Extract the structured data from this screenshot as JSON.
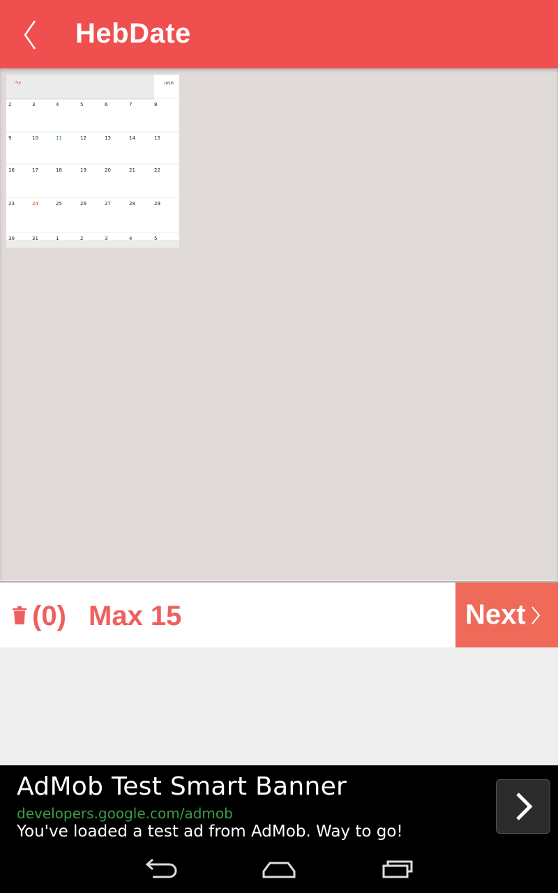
{
  "appbar": {
    "title": "HebDate"
  },
  "gallery": {
    "thumbnail": {
      "header_right": "תמוז",
      "header_left": "יולי",
      "rows": [
        [
          "2",
          "3",
          "4",
          "5",
          "6",
          "7",
          "8"
        ],
        [
          "9",
          "10",
          "11",
          "12",
          "13",
          "14",
          "15"
        ],
        [
          "16",
          "17",
          "18",
          "19",
          "20",
          "21",
          "22"
        ],
        [
          "23",
          "24",
          "25",
          "26",
          "27",
          "28",
          "29"
        ],
        [
          "30",
          "31",
          "1",
          "2",
          "3",
          "4",
          "5"
        ]
      ]
    }
  },
  "bottombar": {
    "count_label": "(0)",
    "max_label": "Max 15",
    "next_label": "Next"
  },
  "ad": {
    "title": "AdMob Test Smart Banner",
    "url": "developers.google.com/admob",
    "description": "You've loaded a test ad from AdMob. Way to go!"
  },
  "colors": {
    "accent": "#ef4f4f",
    "next_bg": "#ef6a58",
    "label": "#ef5f5f"
  },
  "icons": [
    "back-arrow-icon",
    "trash-icon",
    "chevron-right-icon",
    "nav-back-icon",
    "nav-home-icon",
    "nav-recents-icon"
  ]
}
